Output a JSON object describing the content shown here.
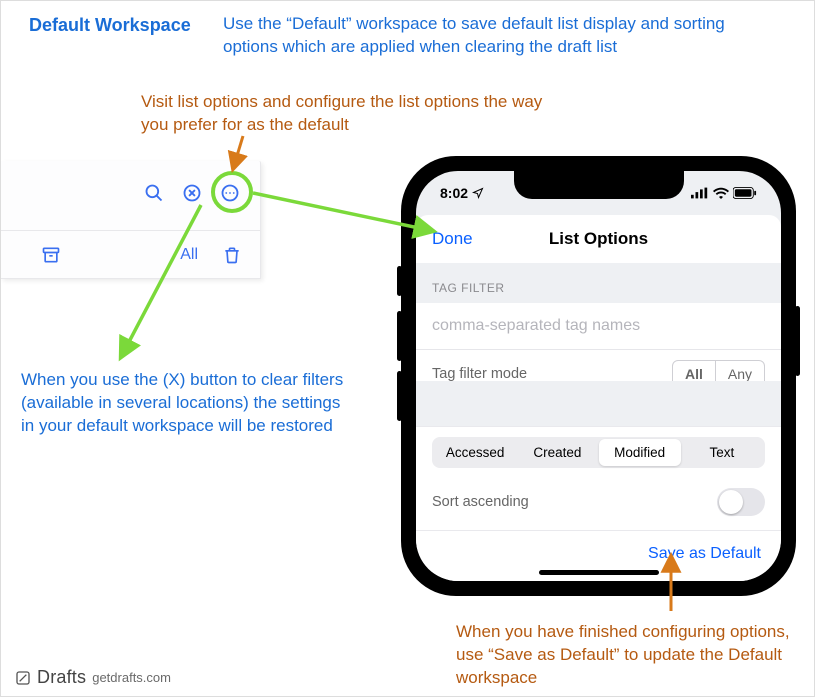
{
  "header": {
    "title": "Default Workspace",
    "description": "Use the “Default” workspace to save default list display and sorting options which are applied when clearing the draft list"
  },
  "annotations": {
    "top": "Visit list options and configure the list options the way you prefer for as the default",
    "left": "When you use the (X) button to clear filters (available in several locations) the settings in your default workspace will be restored",
    "bottom": "When you have finished configuring options, use “Save as Default” to update the Default workspace"
  },
  "panel": {
    "icons": {
      "search": "search-icon",
      "clear": "x-circle-icon",
      "more": "more-icon",
      "archive": "archive-box-icon",
      "trash": "trash-icon"
    },
    "all_label": "All"
  },
  "phone": {
    "status": {
      "time": "8:02",
      "nav_glyph": "➤",
      "signal": "•••",
      "wifi": "wifi",
      "battery": "battery"
    },
    "sheet": {
      "done": "Done",
      "title": "List Options",
      "tag_filter_label": "TAG FILTER",
      "tag_filter_placeholder": "comma-separated tag names",
      "tag_mode_label": "Tag filter mode",
      "tag_mode_options": [
        "All",
        "Any"
      ],
      "tag_mode_selected": "All",
      "sort_options": [
        "Accessed",
        "Created",
        "Modified",
        "Text"
      ],
      "sort_selected": "Modified",
      "sort_ascending_label": "Sort ascending",
      "sort_ascending": false,
      "save_label": "Save as Default"
    }
  },
  "footer": {
    "brand": "Drafts",
    "site": "getdrafts.com"
  },
  "colors": {
    "blue": "#1a6dd6",
    "brown": "#b55a11",
    "brown_arrow": "#d87a1a",
    "green": "#7bd93a",
    "ios_blue": "#0a60ff"
  }
}
